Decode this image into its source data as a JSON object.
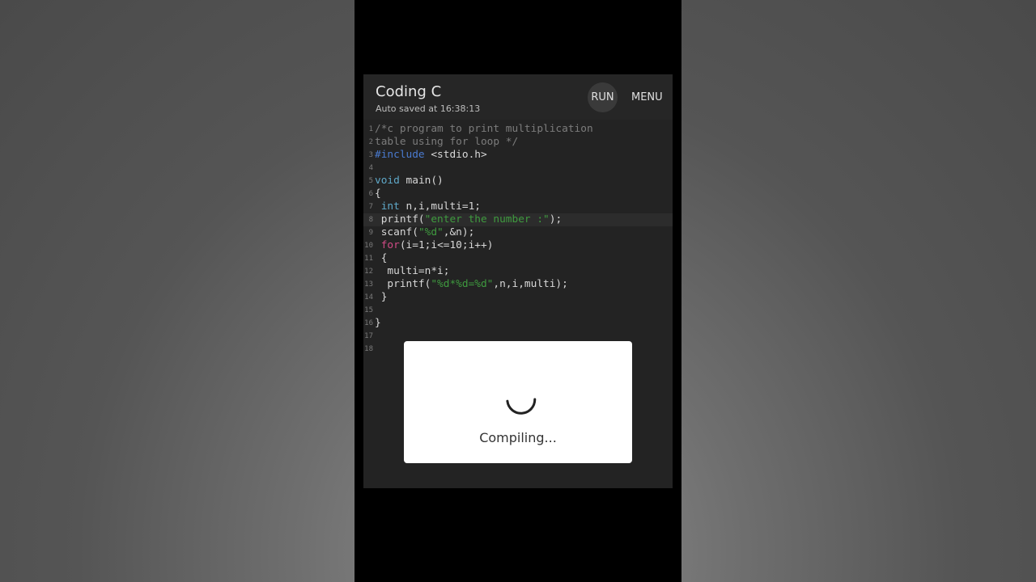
{
  "app": {
    "title": "Coding C",
    "subtitle": "Auto saved at 16:38:13",
    "run_label": "RUN",
    "menu_label": "MENU"
  },
  "editor": {
    "active_line": 8,
    "lines": [
      {
        "n": "1",
        "text": "/*c program to print multiplication"
      },
      {
        "n": "2",
        "text": "table using for loop */"
      },
      {
        "n": "3",
        "text": "#include <stdio.h>"
      },
      {
        "n": "4",
        "text": ""
      },
      {
        "n": "5",
        "text": "void main()"
      },
      {
        "n": "6",
        "text": "{"
      },
      {
        "n": "7",
        "text": " int n,i,multi=1;"
      },
      {
        "n": "8",
        "text": " printf(\"enter the number :\");"
      },
      {
        "n": "9",
        "text": " scanf(\"%d\",&n);"
      },
      {
        "n": "10",
        "text": " for(i=1;i<=10;i++)"
      },
      {
        "n": "11",
        "text": " {"
      },
      {
        "n": "12",
        "text": "  multi=n*i;"
      },
      {
        "n": "13",
        "text": "  printf(\"%d*%d=%d\",n,i,multi);"
      },
      {
        "n": "14",
        "text": " }"
      },
      {
        "n": "15",
        "text": ""
      },
      {
        "n": "16",
        "text": "}"
      },
      {
        "n": "17",
        "text": ""
      },
      {
        "n": "18",
        "text": ""
      }
    ]
  },
  "dialog": {
    "status": "Compiling..."
  },
  "colors": {
    "comment": "#7c7c7c",
    "preprocessor": "#4a7bd0",
    "type": "#5fa8c8",
    "string": "#3f9b3f",
    "keyword": "#d14b86"
  }
}
